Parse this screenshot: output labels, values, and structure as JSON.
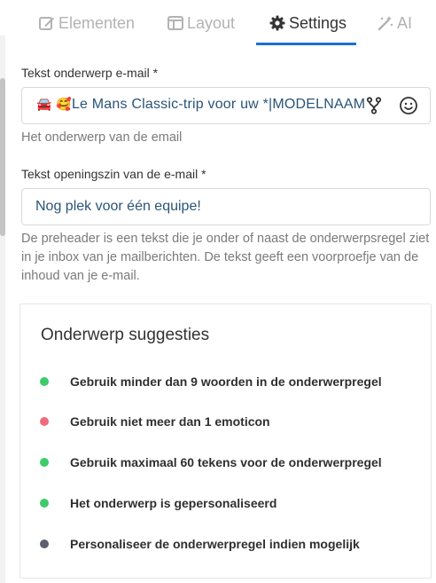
{
  "tabs": [
    {
      "label": "Elementen",
      "icon": "edit-icon",
      "active": false
    },
    {
      "label": "Layout",
      "icon": "layout-icon",
      "active": false
    },
    {
      "label": "Settings",
      "icon": "gear-icon",
      "active": true
    },
    {
      "label": "AI",
      "icon": "magic-wand-icon",
      "active": false
    }
  ],
  "colors": {
    "accent": "#1e6fd0",
    "inactive_tab": "#b3b3b3",
    "input_text": "#2a5478",
    "status_green": "#3ecb6a",
    "status_red": "#ef6b7c",
    "status_gray": "#5b5f6e"
  },
  "subject": {
    "label": "Tekst onderwerp e-mail *",
    "emoji_car": "🚘",
    "emoji_face": "🥰",
    "value_text": "Le Mans Classic-trip voor uw *|MODELNAAM",
    "help": "Het onderwerp van de email"
  },
  "preheader": {
    "label": "Tekst openingszin van de e-mail *",
    "value": "Nog plek voor één equipe!",
    "help": "De preheader is een tekst die je onder of naast de onderwerpsregel ziet in je inbox van je mailberichten. De tekst geeft een voorproefje van de inhoud van je e-mail."
  },
  "suggestions": {
    "title": "Onderwerp suggesties",
    "items": [
      {
        "text": "Gebruik minder dan 9 woorden in de onderwerpregel",
        "status": "green"
      },
      {
        "text": "Gebruik niet meer dan 1 emoticon",
        "status": "red"
      },
      {
        "text": "Gebruik maximaal 60 tekens voor de onderwerpregel",
        "status": "green"
      },
      {
        "text": "Het onderwerp is gepersonaliseerd",
        "status": "green"
      },
      {
        "text": "Personaliseer de onderwerpregel indien mogelijk",
        "status": "gray"
      }
    ]
  }
}
